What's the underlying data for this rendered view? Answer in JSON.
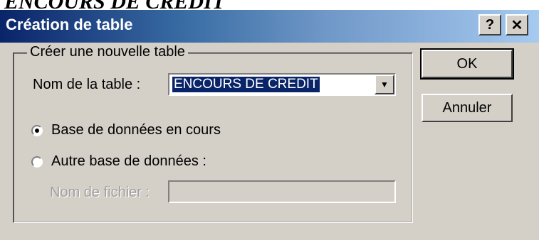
{
  "caption": "ENCOURS DE CREDIT",
  "dialog": {
    "title": "Création de table",
    "help_glyph": "?",
    "close_glyph": "✕",
    "colors": {
      "titlebar_start": "#0a246a",
      "titlebar_end": "#a6caf0",
      "face": "#d4d0c8",
      "selection": "#0a246a"
    }
  },
  "group": {
    "legend": "Créer une nouvelle table",
    "table_name_label": "Nom de la table :",
    "table_name_value": "ENCOURS DE CREDIT",
    "dropdown_glyph": "▼",
    "radio_current": {
      "label": "Base de données en cours",
      "checked": true
    },
    "radio_other": {
      "label": "Autre base de données :",
      "checked": false
    },
    "file_name_label": "Nom de fichier :",
    "file_name_value": ""
  },
  "buttons": {
    "ok": "OK",
    "cancel": "Annuler"
  }
}
